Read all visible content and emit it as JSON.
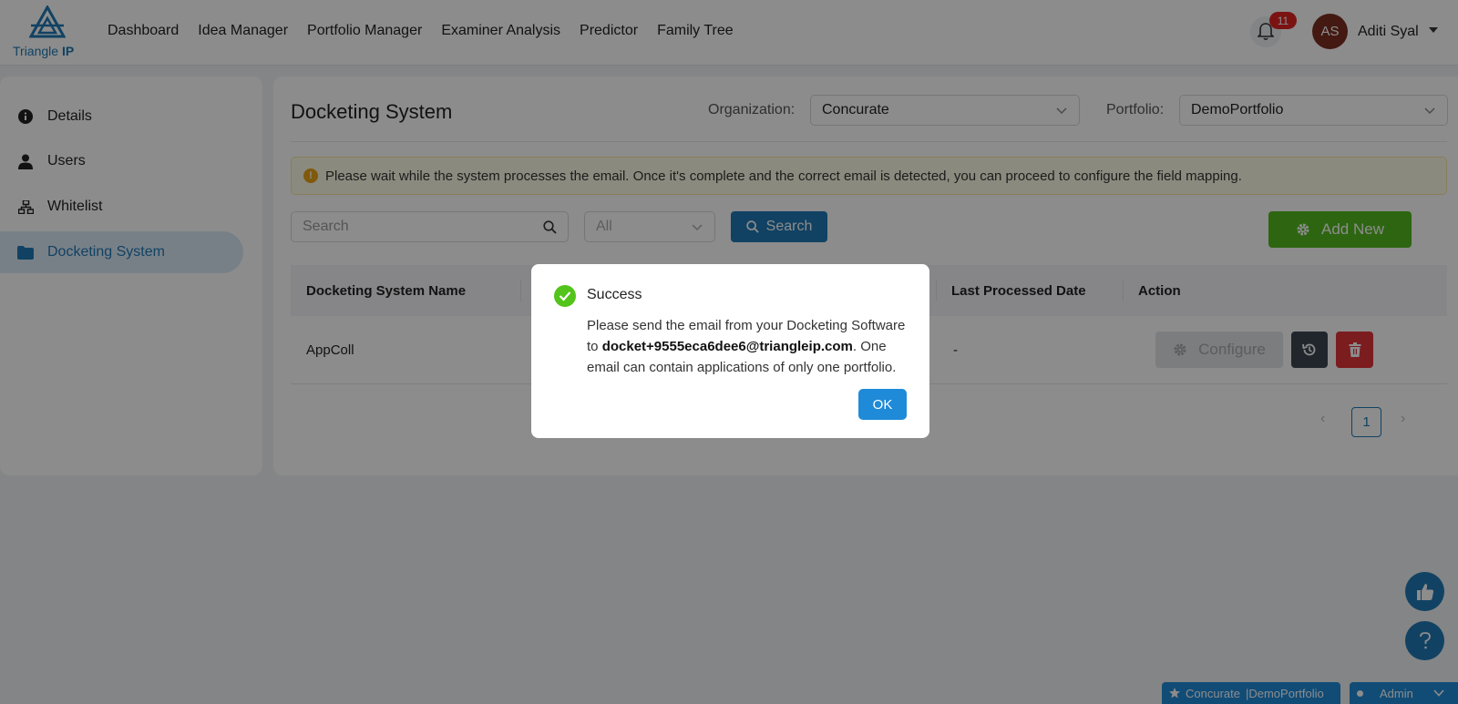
{
  "app": {
    "logo_text_a": "Triangle",
    "logo_text_b": "IP",
    "brand_color": "#1f78b4"
  },
  "nav": {
    "items": [
      "Dashboard",
      "Idea Manager",
      "Portfolio Manager",
      "Examiner Analysis",
      "Predictor",
      "Family Tree"
    ]
  },
  "header": {
    "notification_count": "11",
    "avatar_initials": "AS",
    "user_name": "Aditi Syal"
  },
  "sidebar": {
    "items": [
      {
        "label": "Details",
        "icon": "info-icon"
      },
      {
        "label": "Users",
        "icon": "user-icon"
      },
      {
        "label": "Whitelist",
        "icon": "network-icon"
      },
      {
        "label": "Docketing System",
        "icon": "folder-icon",
        "active": true
      }
    ]
  },
  "main": {
    "title": "Docketing System",
    "organization_label": "Organization:",
    "organization_value": "Concurate",
    "portfolio_label": "Portfolio:",
    "portfolio_value": "DemoPortfolio",
    "alert_text": "Please wait while the system processes the email. Once it's complete and the correct email is detected, you can proceed to configure the field mapping.",
    "search_placeholder": "Search",
    "filter_value": "All",
    "search_button": "Search",
    "add_button": "Add New",
    "table": {
      "columns": [
        "Docketing System Name",
        "Last Processed Date",
        "Action"
      ],
      "rows": [
        {
          "name": "AppColl",
          "last_processed": "-",
          "configure_label": "Configure"
        }
      ]
    },
    "pagination": {
      "current": "1",
      "prev": "‹",
      "next": "›"
    }
  },
  "footer": {
    "org_name": "Concurate",
    "portfolio_name": "|DemoPortfolio",
    "role": "Admin"
  },
  "modal": {
    "title": "Success",
    "body_prefix": "Please send the email from your Docketing Software to ",
    "email": "docket+9555eca6dee6@triangleip.com",
    "body_suffix": ". One email can contain applications of only one portfolio.",
    "ok_label": "OK"
  }
}
